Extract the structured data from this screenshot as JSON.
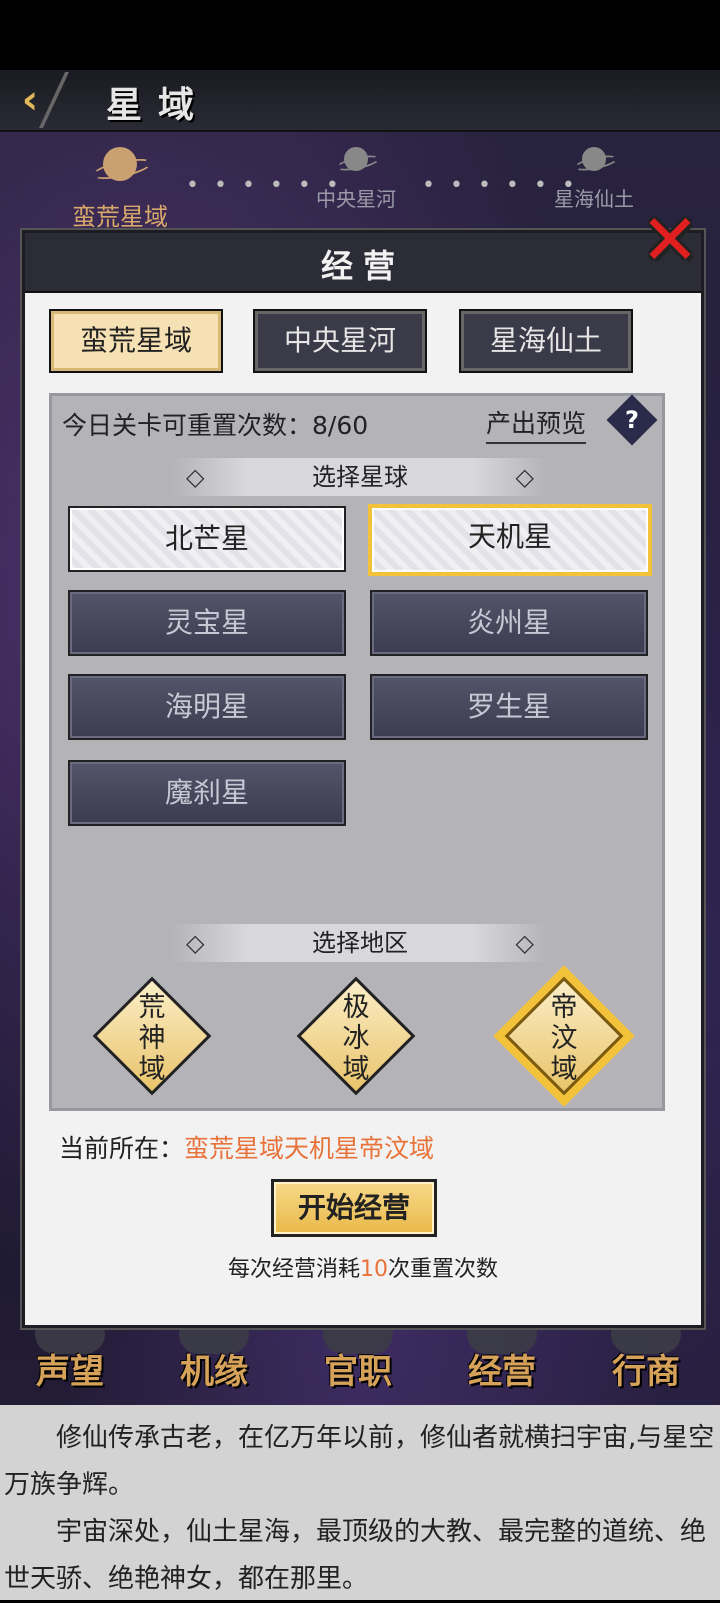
{
  "header": {
    "title": "星域",
    "back_icon": "back-arrow-icon"
  },
  "region_nav": {
    "nodes": [
      {
        "label": "蛮荒星域",
        "active": true
      },
      {
        "label": "中央星河",
        "active": false
      },
      {
        "label": "星海仙土",
        "active": false
      }
    ],
    "connector": "• • • • • •"
  },
  "dialog": {
    "title": "经营",
    "close_icon": "close-x-icon",
    "domain_tabs": [
      {
        "label": "蛮荒星域",
        "active": true
      },
      {
        "label": "中央星河",
        "active": false
      },
      {
        "label": "星海仙土",
        "active": false
      }
    ],
    "reset_count": "今日关卡可重置次数：8/60",
    "preview_link": "产出预览",
    "help_icon": "?",
    "planet_section": {
      "title": "选择星球",
      "diamond": "◇"
    },
    "planets": [
      {
        "label": "北芒星",
        "state": "unlocked"
      },
      {
        "label": "天机星",
        "state": "selected"
      },
      {
        "label": "灵宝星",
        "state": "locked"
      },
      {
        "label": "炎州星",
        "state": "locked"
      },
      {
        "label": "海明星",
        "state": "locked"
      },
      {
        "label": "罗生星",
        "state": "locked"
      },
      {
        "label": "魔刹星",
        "state": "locked"
      }
    ],
    "district_section": {
      "title": "选择地区",
      "diamond": "◇"
    },
    "districts": [
      {
        "lines": [
          "荒",
          "神",
          "域"
        ],
        "selected": false
      },
      {
        "lines": [
          "极",
          "冰",
          "域"
        ],
        "selected": false
      },
      {
        "lines": [
          "帝",
          "汶",
          "域"
        ],
        "selected": true
      }
    ],
    "location": {
      "label": "当前所在：",
      "value": "蛮荒星域天机星帝汶域"
    },
    "start_button": "开始经营",
    "cost": {
      "prefix": "每次经营消耗",
      "number": "10",
      "suffix": "次重置次数"
    }
  },
  "bottom_tabs": [
    "声望",
    "机缘",
    "官职",
    "经营",
    "行商"
  ],
  "story": {
    "paragraphs": [
      "修仙传承古老，在亿万年以前，修仙者就横扫宇宙,与星空万族争辉。",
      "宇宙深处，仙土星海，最顶级的大教、最完整的道统、绝世天骄、绝艳神女，都在那里。"
    ]
  },
  "colors": {
    "accent": "#f2c23a",
    "highlight_text": "#e8733a",
    "danger": "#e02020"
  }
}
